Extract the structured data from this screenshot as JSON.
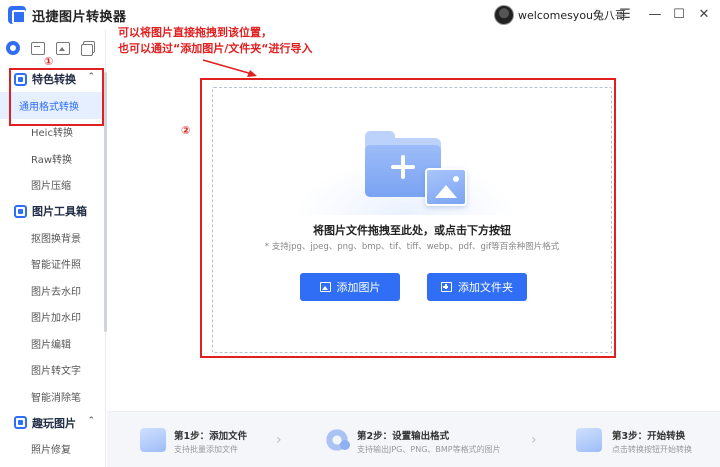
{
  "app": {
    "title": "迅捷图片转换器"
  },
  "user": {
    "name": "welcomesyou兔八哥"
  },
  "window_controls": {
    "menu": "☰",
    "minimize": "—",
    "maximize": "☐",
    "close": "✕"
  },
  "icon_tabs": [
    {
      "icon": "convert-circle-icon",
      "active": true
    },
    {
      "icon": "image-box-icon"
    },
    {
      "icon": "image-icon"
    },
    {
      "icon": "copy-icon"
    }
  ],
  "sidebar": {
    "groups": [
      {
        "label": "特色转换",
        "icon": "convert-icon",
        "chevron": "⌃",
        "items": [
          "通用格式转换",
          "Heic转换",
          "Raw转换",
          "图片压缩"
        ]
      },
      {
        "label": "图片工具箱",
        "icon": "toolbox-icon",
        "items": [
          "抠图换背景",
          "智能证件照",
          "图片去水印",
          "图片加水印",
          "图片编辑",
          "图片转文字",
          "智能消除笔"
        ]
      },
      {
        "label": "趣玩图片",
        "icon": "fun-icon",
        "chevron": "⌃",
        "items": [
          "照片修复"
        ]
      }
    ],
    "active_item": "通用格式转换"
  },
  "annotations": {
    "marker1": "①",
    "marker2": "②",
    "line1": "可以将图片直接拖拽到该位置，",
    "line2": "也可以通过“添加图片/文件夹“进行导入",
    "color": "#e02020"
  },
  "dropzone": {
    "title": "将图片文件拖拽至此处，或点击下方按钮",
    "subtitle": "* 支持jpg、jpeg、png、bmp、tif、tiff、webp、pdf、gif等百余种图片格式",
    "add_image_label": "添加图片",
    "add_folder_label": "添加文件夹"
  },
  "steps": [
    {
      "title": "第1步：添加文件",
      "desc": "支持批量添加文件"
    },
    {
      "title": "第2步：设置输出格式",
      "desc": "支持输出JPG、PNG、BMP等格式的图片"
    },
    {
      "title": "第3步：开始转换",
      "desc": "点击转换按钮开始转换"
    }
  ],
  "colors": {
    "accent": "#2f6ef5",
    "highlight": "#e02020"
  }
}
